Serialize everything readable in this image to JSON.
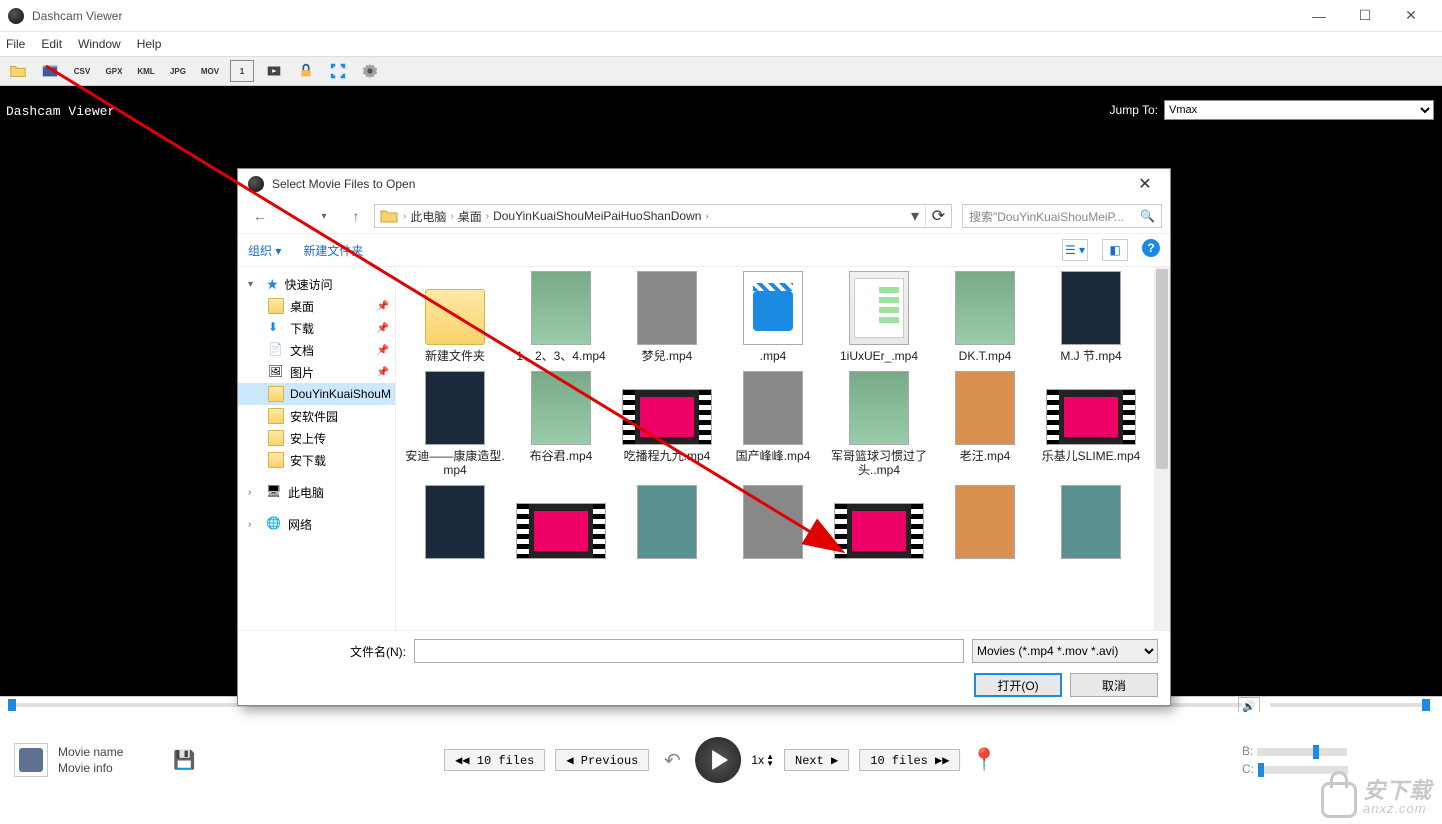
{
  "app": {
    "title": "Dashcam Viewer",
    "menus": [
      "File",
      "Edit",
      "Window",
      "Help"
    ],
    "toolbar": [
      "open",
      "video",
      "CSV",
      "GPX",
      "KML",
      "JPG",
      "MOV",
      "one",
      "clip",
      "lock",
      "fullscreen",
      "gear"
    ],
    "viewer_label": "Dashcam Viewer",
    "jump_label": "Jump To:",
    "jump_value": "Vmax"
  },
  "dialog": {
    "title": "Select Movie Files to Open",
    "breadcrumb": [
      "此电脑",
      "桌面",
      "DouYinKuaiShouMeiPaiHuoShanDown"
    ],
    "search_placeholder": "搜索\"DouYinKuaiShouMeiP...",
    "organize": "组织",
    "new_folder": "新建文件夹",
    "tree": {
      "quick": "快速访问",
      "items_pinned": [
        "桌面",
        "下载",
        "文档",
        "图片"
      ],
      "items_sub": [
        "DouYinKuaiShouM",
        "安软件园",
        "安上传",
        "安下载"
      ],
      "this_pc": "此电脑",
      "network": "网络"
    },
    "files_row1": [
      {
        "name": "新建文件夹",
        "type": "folder"
      },
      {
        "name": "1、2、3、4.mp4",
        "type": "photo"
      },
      {
        "name": "梦兒.mp4",
        "type": "video"
      },
      {
        "name": ".mp4",
        "type": "videoicon"
      },
      {
        "name": "1iUxUEr_.mp4",
        "type": "chat"
      },
      {
        "name": "DK.T.mp4",
        "type": "photo"
      },
      {
        "name": "M.J 节.mp4",
        "type": "dark"
      }
    ],
    "files_row2": [
      {
        "name": "安迪——康康造型.mp4",
        "type": "dark"
      },
      {
        "name": "布谷君.mp4",
        "type": "photo"
      },
      {
        "name": "吃播程九九.mp4",
        "type": "film"
      },
      {
        "name": "国产峰峰.mp4",
        "type": "video"
      },
      {
        "name": "军哥篮球习惯过了头..mp4",
        "type": "photo"
      },
      {
        "name": "老汪.mp4",
        "type": "orange"
      },
      {
        "name": "乐基儿SLIME.mp4",
        "type": "film"
      }
    ],
    "files_row3": [
      {
        "name": "",
        "type": "dark"
      },
      {
        "name": "",
        "type": "film"
      },
      {
        "name": "",
        "type": "teal"
      },
      {
        "name": "",
        "type": "video"
      },
      {
        "name": "",
        "type": "film"
      },
      {
        "name": "",
        "type": "orange"
      },
      {
        "name": "",
        "type": "teal"
      }
    ],
    "filename_label": "文件名(N):",
    "filter": "Movies (*.mp4 *.mov *.avi)",
    "open_btn": "打开(O)",
    "cancel_btn": "取消"
  },
  "player": {
    "movie_name": "Movie name",
    "movie_info": "Movie info",
    "back10": "◀◀ 10 files",
    "prev": "◀ Previous",
    "speed": "1x",
    "next": "Next ▶",
    "fwd10": "10 files ▶▶",
    "b_label": "B:",
    "c_label": "C:"
  },
  "watermark": {
    "main": "安下载",
    "sub": "anxz.com"
  }
}
